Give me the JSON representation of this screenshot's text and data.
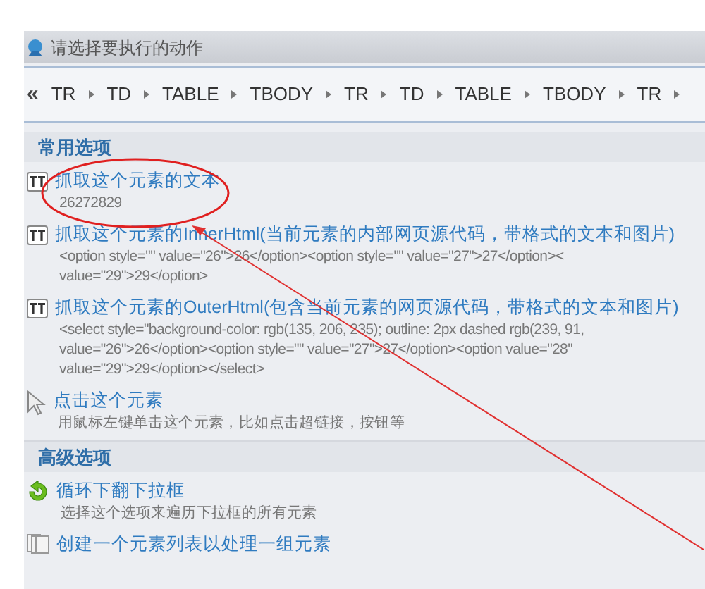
{
  "window": {
    "title": "请选择要执行的动作"
  },
  "breadcrumb": {
    "back": "«",
    "items": [
      "TR",
      "TD",
      "TABLE",
      "TBODY",
      "TR",
      "TD",
      "TABLE",
      "TBODY",
      "TR"
    ]
  },
  "sections": [
    {
      "title": "常用选项",
      "items": [
        {
          "kind": "text",
          "title": "抓取这个元素的文本",
          "lines": [
            "26272829"
          ]
        },
        {
          "kind": "text",
          "title": "抓取这个元素的InnerHtml(当前元素的内部网页源代码，带格式的文本和图片)",
          "lines": [
            "<option style=\"\" value=\"26\">26</option><option style=\"\" value=\"27\">27</option><",
            "value=\"29\">29</option>"
          ]
        },
        {
          "kind": "text",
          "title": "抓取这个元素的OuterHtml(包含当前元素的网页源代码，带格式的文本和图片)",
          "lines": [
            "<select style=\"background-color: rgb(135, 206, 235); outline: 2px dashed rgb(239, 91,",
            "value=\"26\">26</option><option style=\"\" value=\"27\">27</option><option value=\"28\"",
            "value=\"29\">29</option></select>"
          ]
        },
        {
          "kind": "cursor",
          "title": "点击这个元素",
          "lines": [
            "用鼠标左键单击这个元素，比如点击超链接，按钮等"
          ]
        }
      ]
    },
    {
      "title": "高级选项",
      "items": [
        {
          "kind": "loop",
          "title": "循环下翻下拉框",
          "lines": [
            "选择这个选项来遍历下拉框的所有元素"
          ]
        },
        {
          "kind": "list",
          "title": "创建一个元素列表以处理一组元素"
        }
      ]
    }
  ]
}
